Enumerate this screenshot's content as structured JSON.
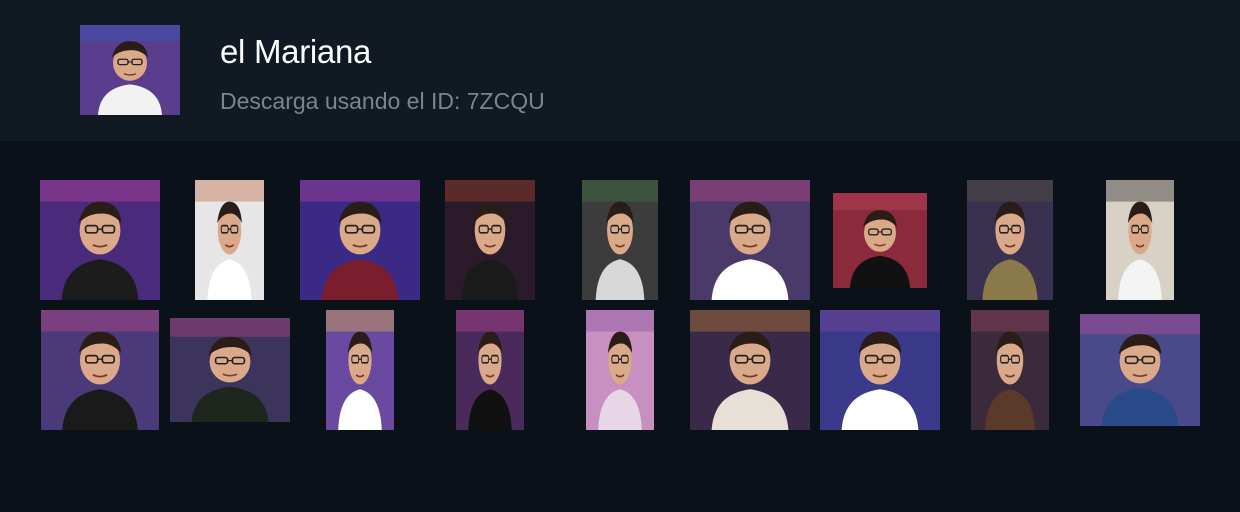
{
  "pack": {
    "name": "el Mariana",
    "download_text": "Descarga usando el ID: 7ZCQU",
    "cover": {
      "bg": "#5a3d8c",
      "shirt": "#f2f2f2",
      "accent": "#2d62c8"
    }
  },
  "stickers": [
    {
      "id": "sticker-1",
      "bg": "#4a2a7a",
      "shirt": "#1c1c1c",
      "accent": "#d04aa8"
    },
    {
      "id": "sticker-2",
      "bg": "#e6e6e6",
      "shirt": "#ffffff",
      "accent": "#b8562a"
    },
    {
      "id": "sticker-3",
      "bg": "#3a2a86",
      "shirt": "#7a1e2e",
      "accent": "#c84a9a"
    },
    {
      "id": "sticker-4",
      "bg": "#2a1a2a",
      "shirt": "#1a1a1a",
      "accent": "#b84a2a"
    },
    {
      "id": "sticker-5",
      "bg": "#3c3c3c",
      "shirt": "#d8d8d8",
      "accent": "#3c7a3c"
    },
    {
      "id": "sticker-6",
      "bg": "#4a3a6a",
      "shirt": "#ffffff",
      "accent": "#d04a8a"
    },
    {
      "id": "sticker-7",
      "bg": "#8a2a3a",
      "shirt": "#111111",
      "accent": "#c84a6a"
    },
    {
      "id": "sticker-8",
      "bg": "#3a3050",
      "shirt": "#8a7a4a",
      "accent": "#5a5a3a"
    },
    {
      "id": "sticker-9",
      "bg": "#d8d2c6",
      "shirt": "#f4f4f4",
      "accent": "#111111"
    },
    {
      "id": "sticker-10",
      "bg": "#4a3a7a",
      "shirt": "#1a1a1a",
      "accent": "#d04a8a"
    },
    {
      "id": "sticker-11",
      "bg": "#3c345a",
      "shirt": "#1e261e",
      "accent": "#c04a90"
    },
    {
      "id": "sticker-12",
      "bg": "#6a4aa0",
      "shirt": "#ffffff",
      "accent": "#f2c23a"
    },
    {
      "id": "sticker-13",
      "bg": "#4a2a5a",
      "shirt": "#111111",
      "accent": "#c84a9a"
    },
    {
      "id": "sticker-14",
      "bg": "#c890c0",
      "shirt": "#e6d6e6",
      "accent": "#7a4a9a"
    },
    {
      "id": "sticker-15",
      "bg": "#3a2a4a",
      "shirt": "#e6e0d6",
      "accent": "#d08a2a"
    },
    {
      "id": "sticker-16",
      "bg": "#3a3a8a",
      "shirt": "#ffffff",
      "accent": "#8a4a9a"
    },
    {
      "id": "sticker-17",
      "bg": "#3a2a3a",
      "shirt": "#5a3a2a",
      "accent": "#a84a6a"
    },
    {
      "id": "sticker-18",
      "bg": "#4a4a8a",
      "shirt": "#2a4a8a",
      "accent": "#d04a9a"
    }
  ]
}
